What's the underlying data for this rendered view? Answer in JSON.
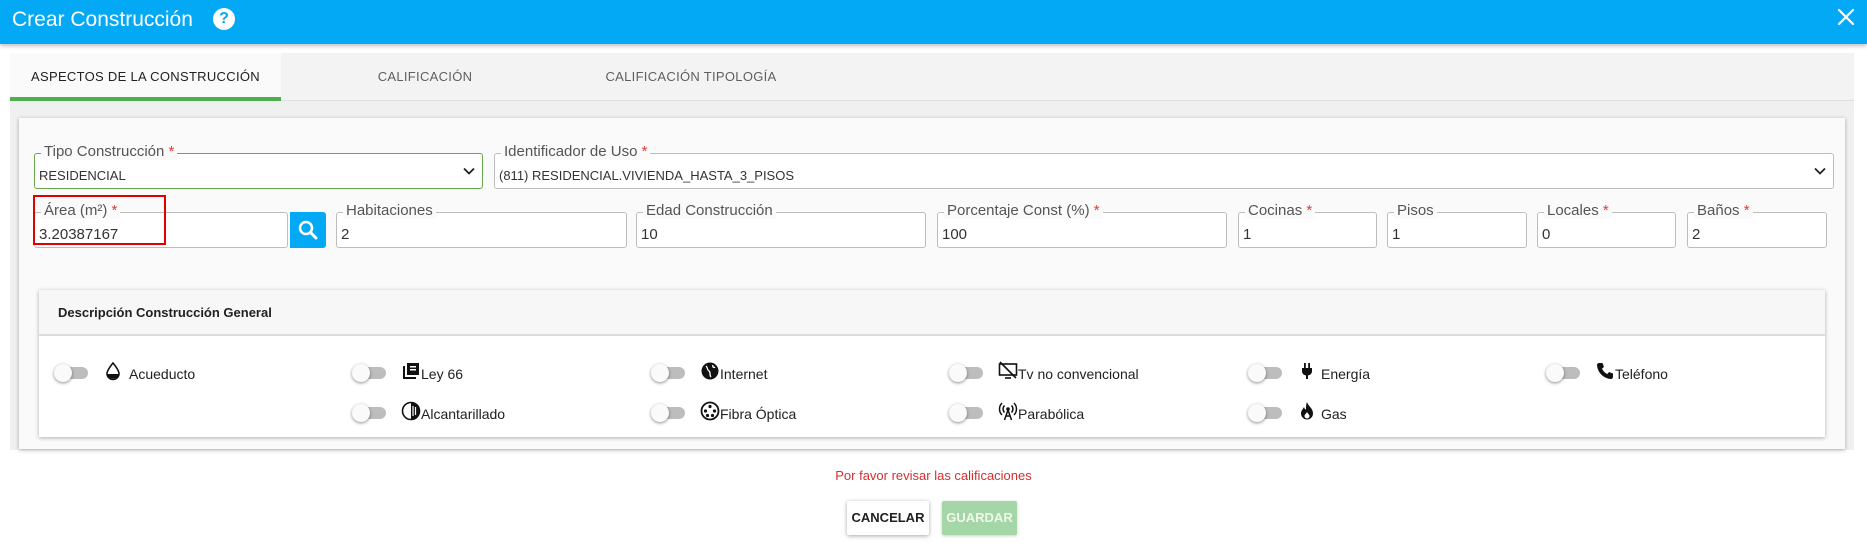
{
  "dialog": {
    "title": "Crear Construcción",
    "help_icon": "help-circle-icon",
    "close_icon": "close-icon"
  },
  "tabs": [
    {
      "label": "ASPECTOS DE LA CONSTRUCCIÓN",
      "active": true
    },
    {
      "label": "CALIFICACIÓN",
      "active": false
    },
    {
      "label": "CALIFICACIÓN TIPOLOGÍA",
      "active": false
    }
  ],
  "form": {
    "tipo_construccion": {
      "label": "Tipo Construcción",
      "required": "*",
      "value": "RESIDENCIAL"
    },
    "identificador_uso": {
      "label": "Identificador de Uso",
      "required": "*",
      "value": "(811) RESIDENCIAL.VIVIENDA_HASTA_3_PISOS"
    },
    "area": {
      "label": "Área (m²)",
      "required": "*",
      "value": "3.20387167"
    },
    "habitaciones": {
      "label": "Habitaciones",
      "value": "2"
    },
    "edad_construccion": {
      "label": "Edad Construcción",
      "value": "10"
    },
    "porcentaje_const": {
      "label": "Porcentaje Const (%)",
      "required": "*",
      "value": "100"
    },
    "cocinas": {
      "label": "Cocinas",
      "required": "*",
      "value": "1"
    },
    "pisos": {
      "label": "Pisos",
      "value": "1"
    },
    "locales": {
      "label": "Locales",
      "required": "*",
      "value": "0"
    },
    "banos": {
      "label": "Baños",
      "required": "*",
      "value": "2"
    }
  },
  "descripcion": {
    "title": "Descripción Construcción General",
    "options": [
      {
        "label": "Acueducto",
        "icon": "water-drop-icon",
        "on": false
      },
      {
        "label": "Ley 66",
        "icon": "library-books-icon",
        "on": false
      },
      {
        "label": "Internet",
        "icon": "globe-icon",
        "on": false
      },
      {
        "label": "Tv no convencional",
        "icon": "tv-off-icon",
        "on": false
      },
      {
        "label": "Energía",
        "icon": "power-plug-icon",
        "on": false
      },
      {
        "label": "Teléfono",
        "icon": "phone-icon",
        "on": false
      },
      {
        "label": "Alcantarillado",
        "icon": "sewer-icon",
        "on": false
      },
      {
        "label": "Fibra Óptica",
        "icon": "fiber-optic-icon",
        "on": false
      },
      {
        "label": "Parabólica",
        "icon": "satellite-antenna-icon",
        "on": false
      },
      {
        "label": "Gas",
        "icon": "flame-icon",
        "on": false
      }
    ]
  },
  "footer": {
    "error": "Por favor revisar las calificaciones",
    "cancel_label": "CANCELAR",
    "save_label": "GUARDAR"
  },
  "colors": {
    "primary": "#03a9f4",
    "active_tab_indicator": "#4caf50",
    "required_marker": "#e53935",
    "error_text": "#d32f2f",
    "highlight_outline": "#e00000",
    "save_disabled": "#a5d6a7"
  }
}
